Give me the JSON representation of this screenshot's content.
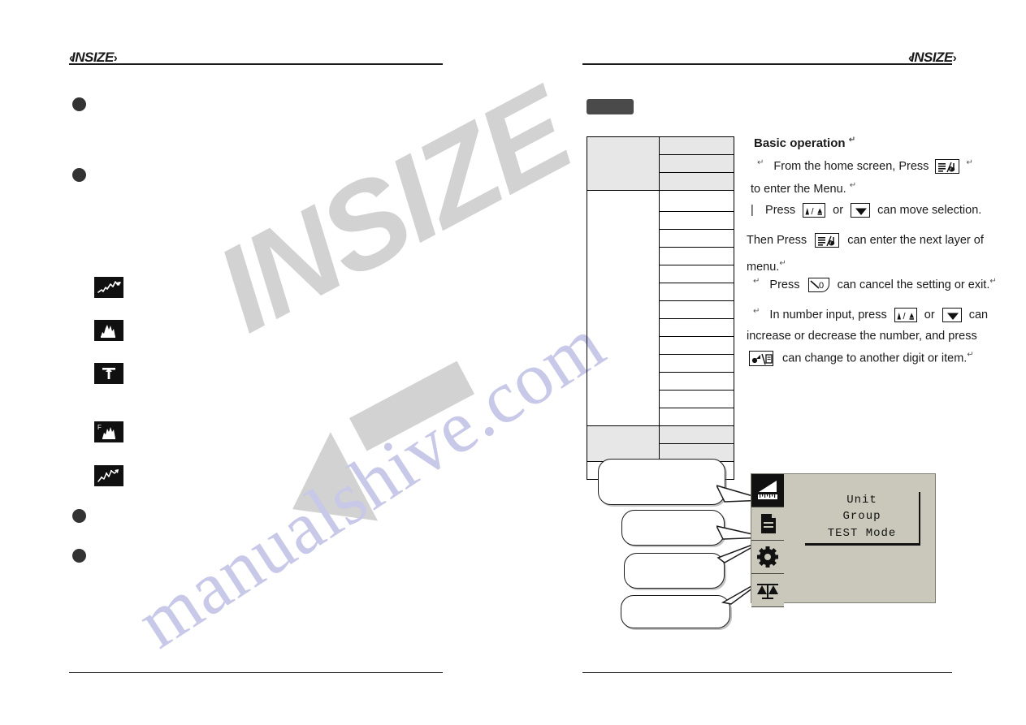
{
  "document": {
    "brand": "INSIZE",
    "brand_arrow_left": "‹",
    "brand_arrow_right": "›",
    "watermark_text": "INSIZE",
    "watermark_site": "manualshive.com"
  },
  "left_page": {
    "bullets": [
      {
        "name": "bullet-1"
      },
      {
        "name": "bullet-2"
      },
      {
        "name": "bullet-3"
      },
      {
        "name": "bullet-4"
      }
    ],
    "icons": [
      {
        "name": "trend-line-icon",
        "label": "trend line graph"
      },
      {
        "name": "histogram-icon",
        "label": "histogram"
      },
      {
        "name": "tolerance-arrow-icon",
        "label": "tolerance arrow"
      },
      {
        "name": "histogram-f-icon",
        "label": "histogram with F"
      },
      {
        "name": "scatter-trend-icon",
        "label": "scatter trend"
      }
    ]
  },
  "right_page": {
    "tab_label": "",
    "table": {
      "rows": 19,
      "columns": 2,
      "cells": []
    },
    "heading": "Basic operation",
    "paragraphs": [
      {
        "id": "p1",
        "lines": [
          {
            "segments": [
              {
                "t": "text",
                "v": "From the home screen, Press "
              },
              {
                "t": "key",
                "v": "menu-enter-key"
              },
              {
                "t": "mark",
                "v": "↵"
              }
            ]
          },
          {
            "segments": [
              {
                "t": "text",
                "v": "to enter the Menu. "
              },
              {
                "t": "mark",
                "v": "↵"
              }
            ]
          }
        ]
      },
      {
        "id": "p2",
        "lines": [
          {
            "segments": [
              {
                "t": "text",
                "v": "Press "
              },
              {
                "t": "key",
                "v": "up-key"
              },
              {
                "t": "text",
                "v": " or "
              },
              {
                "t": "key",
                "v": "down-key"
              },
              {
                "t": "text",
                "v": " can move selection."
              }
            ]
          },
          {
            "segments": [
              {
                "t": "text",
                "v": "Then Press "
              },
              {
                "t": "key",
                "v": "menu-enter-key"
              },
              {
                "t": "text",
                "v": " can enter the next layer of"
              }
            ]
          },
          {
            "segments": [
              {
                "t": "text",
                "v": "menu."
              },
              {
                "t": "mark",
                "v": "↵"
              }
            ]
          }
        ]
      },
      {
        "id": "p3",
        "lines": [
          {
            "segments": [
              {
                "t": "text",
                "v": "Press "
              },
              {
                "t": "key",
                "v": "cancel-zero-key"
              },
              {
                "t": "text",
                "v": " can cancel the setting or exit."
              },
              {
                "t": "mark",
                "v": "↵"
              }
            ]
          }
        ]
      },
      {
        "id": "p4",
        "lines": [
          {
            "segments": [
              {
                "t": "text",
                "v": "In number input, press "
              },
              {
                "t": "key",
                "v": "up-key"
              },
              {
                "t": "text",
                "v": " or "
              },
              {
                "t": "key",
                "v": "down-key"
              },
              {
                "t": "text",
                "v": " can"
              }
            ]
          },
          {
            "segments": [
              {
                "t": "text",
                "v": "increase or decrease the number, and press"
              }
            ]
          },
          {
            "segments": [
              {
                "t": "key",
                "v": "shift-item-key"
              },
              {
                "t": "text",
                "v": " can change to another digit or item."
              },
              {
                "t": "mark",
                "v": "↵"
              }
            ]
          }
        ]
      }
    ],
    "text_lines": {
      "heading": "Basic operation",
      "l1": "From the home screen, Press",
      "l2": "to enter the Menu.",
      "l3a": "Press",
      "l3b": "or",
      "l3c": "can move selection.",
      "l4a": "Then Press",
      "l4b": "can enter the next layer of",
      "l5": "menu.",
      "l6a": "Press",
      "l6b": "can cancel the setting or exit.",
      "l7a": "In number input, press",
      "l7b": "or",
      "l7c": "can",
      "l8": "increase or decrease the number, and press",
      "l9": "can change to another digit or item."
    },
    "callouts": [
      {
        "name": "callout-bubble-1",
        "text": ""
      },
      {
        "name": "callout-bubble-2",
        "text": ""
      },
      {
        "name": "callout-bubble-3",
        "text": ""
      },
      {
        "name": "callout-bubble-4",
        "text": ""
      }
    ],
    "lcd": {
      "menu_items": [
        "Unit",
        "Group",
        "TEST Mode"
      ],
      "sidebar_icons": [
        {
          "name": "measure-ruler-icon",
          "active": true
        },
        {
          "name": "document-icon",
          "active": false
        },
        {
          "name": "gear-icon",
          "active": false
        },
        {
          "name": "balance-scale-icon",
          "active": false
        }
      ],
      "background_color": "#c9c8bb",
      "active_color": "#111111"
    }
  }
}
